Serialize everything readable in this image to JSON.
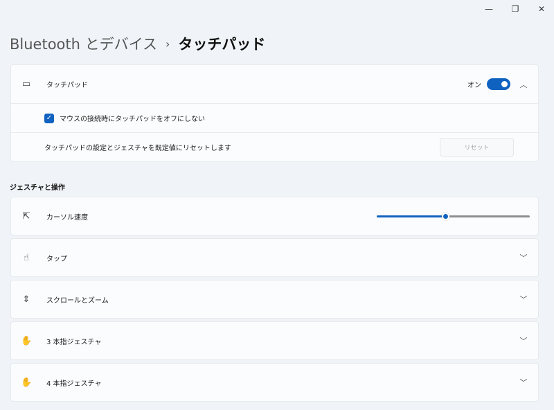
{
  "window": {
    "minimize": "—",
    "restore": "❐",
    "close": "✕"
  },
  "breadcrumb": {
    "parent": "Bluetooth とデバイス",
    "separator": "›",
    "current": "タッチパッド"
  },
  "touchpad": {
    "label": "タッチパッド",
    "toggle_state": "オン",
    "toggle_on": true,
    "checkbox_label": "マウスの接続時にタッチパッドをオフにしない",
    "checkbox_checked": true,
    "reset_desc": "タッチパッドの設定とジェスチャを既定値にリセットします",
    "reset_button": "リセット"
  },
  "section_title": "ジェスチャと操作",
  "cursor_speed": {
    "label": "カーソル速度",
    "value_percent": 45
  },
  "items": [
    {
      "label": "タップ"
    },
    {
      "label": "スクロールとズーム"
    },
    {
      "label": "3 本指ジェスチャ"
    },
    {
      "label": "4 本指ジェスチャ"
    }
  ],
  "colors": {
    "accent": "#0f62c0",
    "background": "#f0f4f8"
  }
}
